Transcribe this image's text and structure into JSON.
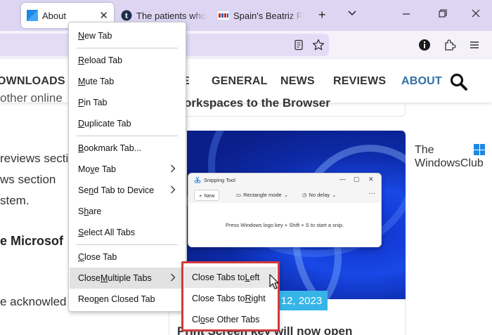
{
  "browser": {
    "tabs": [
      {
        "title": "About",
        "active": true
      },
      {
        "title": "The patients who"
      },
      {
        "title": "Spain's Beatriz Fla"
      }
    ],
    "new_tab_symbol": "+",
    "tab_list_symbol": "⌄",
    "window_controls": {
      "minimize": "—",
      "restore": "❐",
      "close": "✕"
    },
    "accent": "#ddd6f3"
  },
  "site": {
    "nav": [
      "OWNLOADS",
      "E",
      "GENERAL",
      "NEWS",
      "REVIEWS",
      "ABOUT"
    ],
    "active_nav": "ABOUT",
    "article_title_top": "orkspaces to the Browser",
    "left_text": {
      "line1": "other  online",
      "line2": "reviews sectio",
      "line3": "ws section",
      "line4": "stem.",
      "bold": "e  Microsof",
      "line5": "e acknowled"
    },
    "date_chip": "12, 2023",
    "article_title_bottom": "Print Screen key will now open",
    "logo_line1": "The",
    "logo_line2": "WindowsClub"
  },
  "snipping_tool": {
    "title": "Snipping Tool",
    "new_label": "New",
    "mode_label": "Rectangle mode",
    "delay_label": "No delay",
    "more": "···",
    "body_text": "Press Windows logo key + Shift + S to start a snip."
  },
  "context_menu": {
    "items": [
      {
        "label_pre": "",
        "key": "N",
        "label_post": "ew Tab"
      },
      {
        "label_pre": "",
        "key": "R",
        "label_post": "eload Tab"
      },
      {
        "label_pre": "",
        "key": "M",
        "label_post": "ute Tab"
      },
      {
        "label_pre": "",
        "key": "P",
        "label_post": "in Tab"
      },
      {
        "label_pre": "",
        "key": "D",
        "label_post": "uplicate Tab"
      },
      {
        "label_pre": "",
        "key": "B",
        "label_post": "ookmark Tab..."
      },
      {
        "label_pre": "Mo",
        "key": "v",
        "label_post": "e Tab"
      },
      {
        "label_pre": "Se",
        "key": "n",
        "label_post": "d Tab to Device"
      },
      {
        "label_pre": "S",
        "key": "h",
        "label_post": "are"
      },
      {
        "label_pre": "",
        "key": "S",
        "label_post": "elect All Tabs"
      },
      {
        "label_pre": "",
        "key": "C",
        "label_post": "lose Tab"
      },
      {
        "label_pre": "Close ",
        "key": "M",
        "label_post": "ultiple Tabs"
      },
      {
        "label_pre": "Reo",
        "key": "p",
        "label_post": "en Closed Tab"
      }
    ],
    "submenu": [
      {
        "label_pre": "Close Tabs to ",
        "key": "L",
        "label_post": "eft"
      },
      {
        "label_pre": "Close Tabs to ",
        "key": "R",
        "label_post": "ight"
      },
      {
        "label_pre": "Cl",
        "key": "o",
        "label_post": "se Other Tabs"
      }
    ],
    "highlight_color": "#d13b3b"
  }
}
